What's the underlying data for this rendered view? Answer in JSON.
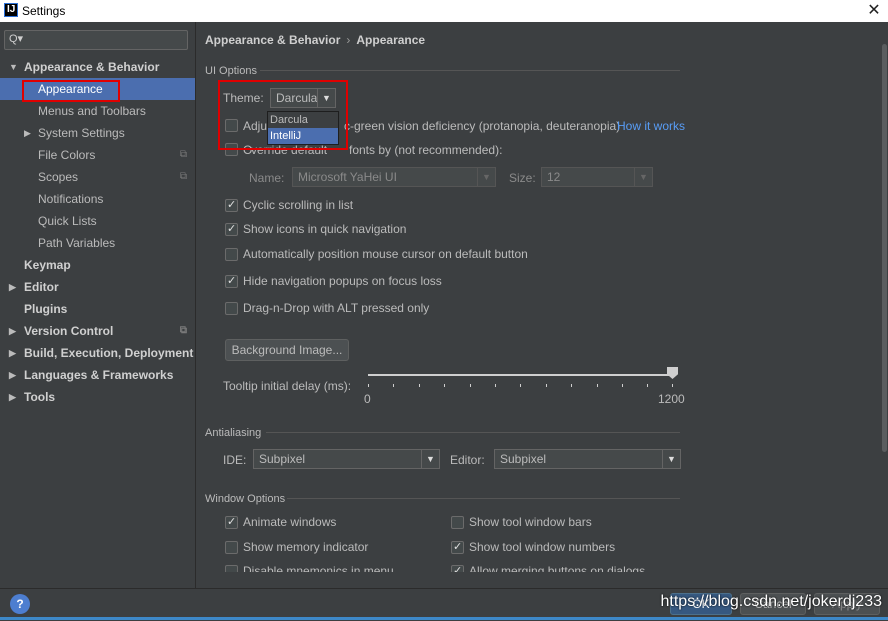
{
  "window": {
    "title": "Settings",
    "app_icon_letter": "IJ"
  },
  "search": {
    "placeholder": "",
    "icon": "search-icon"
  },
  "sidebar": {
    "items": [
      {
        "label": "Appearance & Behavior",
        "arrow": "▼",
        "bold": true
      },
      {
        "label": "Appearance",
        "selected": true
      },
      {
        "label": "Menus and Toolbars"
      },
      {
        "label": "System Settings",
        "arrow": "▶"
      },
      {
        "label": "File Colors",
        "copy_icon": true
      },
      {
        "label": "Scopes",
        "copy_icon": true
      },
      {
        "label": "Notifications"
      },
      {
        "label": "Quick Lists"
      },
      {
        "label": "Path Variables"
      },
      {
        "label": "Keymap",
        "bold": true
      },
      {
        "label": "Editor",
        "arrow": "▶",
        "bold": true
      },
      {
        "label": "Plugins",
        "bold": true
      },
      {
        "label": "Version Control",
        "arrow": "▶",
        "bold": true,
        "copy_icon": true
      },
      {
        "label": "Build, Execution, Deployment",
        "arrow": "▶",
        "bold": true
      },
      {
        "label": "Languages & Frameworks",
        "arrow": "▶",
        "bold": true
      },
      {
        "label": "Tools",
        "arrow": "▶",
        "bold": true
      }
    ]
  },
  "breadcrumb": {
    "parent": "Appearance & Behavior",
    "separator": "›",
    "current": "Appearance"
  },
  "ui_options": {
    "section_title": "UI Options",
    "theme_label": "Theme:",
    "theme_value": "Darcula",
    "theme_options": [
      "Darcula",
      "IntelliJ"
    ],
    "theme_highlighted": "IntelliJ",
    "adjust_colors_label_start": "Adju",
    "adjust_colors_label_end": "c-green vision deficiency (protanopia, deuteranopia)",
    "how_it_works": "How it works",
    "override_fonts_label_start": "O",
    "override_fonts_label_end": "fonts by (not recommended):",
    "override_fonts_obscured": "verride default",
    "font_name_label": "Name:",
    "font_name_value": "Microsoft YaHei UI",
    "font_size_label": "Size:",
    "font_size_value": "12",
    "cyclic_scrolling": "Cyclic scrolling in list",
    "show_icons": "Show icons in quick navigation",
    "auto_position": "Automatically position mouse cursor on default button",
    "hide_navigation": "Hide navigation popups on focus loss",
    "drag_n_drop": "Drag-n-Drop with ALT pressed only",
    "background_image_button": "Background Image...",
    "tooltip_delay_label": "Tooltip initial delay (ms):",
    "tooltip_min": "0",
    "tooltip_max": "1200",
    "tooltip_value_fraction": 1.0
  },
  "checkboxes": {
    "adjust_colors": false,
    "override_fonts": false,
    "cyclic_scrolling": true,
    "show_icons": true,
    "auto_position": false,
    "hide_navigation": true,
    "drag_n_drop": false,
    "animate_windows": true,
    "show_tool_window_bars": false,
    "show_memory": false,
    "show_tool_window_numbers": true
  },
  "antialiasing": {
    "section_title": "Antialiasing",
    "ide_label": "IDE:",
    "ide_value": "Subpixel",
    "editor_label": "Editor:",
    "editor_value": "Subpixel"
  },
  "window_options": {
    "section_title": "Window Options",
    "animate_windows": "Animate windows",
    "show_tool_window_bars": "Show tool window bars",
    "show_memory": "Show memory indicator",
    "show_tool_window_numbers": "Show tool window numbers",
    "disable_mnemonics": "Disable mnemonics in menu",
    "allow_merging": "Allow merging buttons on dialogs"
  },
  "footer": {
    "help_label": "?",
    "ok_label": "OK",
    "cancel_label": "Cancel",
    "apply_label": "Apply",
    "watermark": "https://blog.csdn.net/jokerdj233"
  },
  "colors": {
    "background": "#3c3f41",
    "selection": "#4b6eaf",
    "link": "#589df6",
    "highlight_box": "#e00000"
  }
}
